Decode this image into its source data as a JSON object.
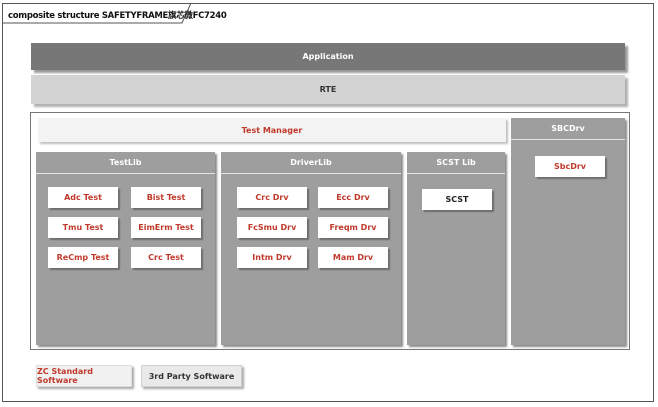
{
  "diagram": {
    "title": "composite structure SAFETYFRAME旗芯微FC7240"
  },
  "layers": {
    "application": "Application",
    "rte": "RTE",
    "test_manager": "Test Manager"
  },
  "panels": {
    "testlib": {
      "title": "TestLib",
      "items": [
        "Adc Test",
        "Bist Test",
        "Tmu Test",
        "EimErm Test",
        "ReCmp Test",
        "Crc Test"
      ]
    },
    "driverlib": {
      "title": "DriverLib",
      "items": [
        "Crc Drv",
        "Ecc Drv",
        "FcSmu Drv",
        "Freqm Drv",
        "Intm Drv",
        "Mam Drv"
      ]
    },
    "scst_lib": {
      "title": "SCST Lib",
      "items": [
        "SCST"
      ]
    },
    "sbcdrv": {
      "title": "SBCDrv",
      "items": [
        "SbcDrv"
      ]
    }
  },
  "legend": {
    "zc_standard": "ZC Standard Software",
    "third_party": "3rd Party Software"
  },
  "colors": {
    "accent_red": "#c0392b",
    "panel_gray": "#9e9e9e",
    "application_gray": "#777777",
    "rte_gray": "#d3d3d3"
  }
}
